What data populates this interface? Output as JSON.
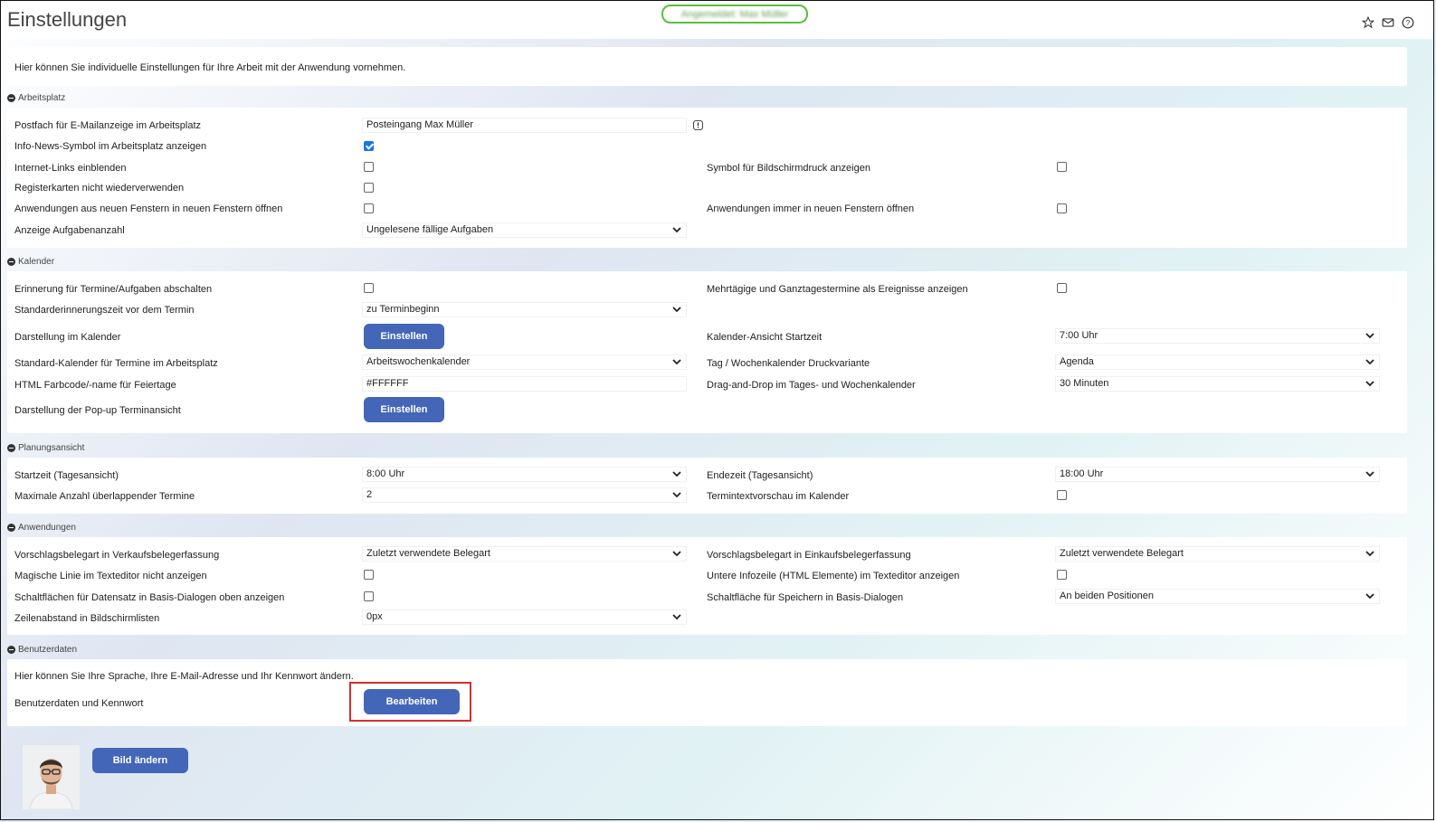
{
  "header": {
    "title": "Einstellungen",
    "badge_text": "Angemeldet: Max Müller",
    "icons": [
      "star-icon",
      "mail-icon",
      "help-icon"
    ]
  },
  "intro": "Hier können Sie individuelle Einstellungen für Ihre Arbeit mit der Anwendung vornehmen.",
  "sections": {
    "arbeitsplatz": {
      "title": "Arbeitsplatz",
      "postfach_label": "Postfach für E-Mailanzeige im Arbeitsplatz",
      "postfach_value": "Posteingang Max Müller",
      "infonews_label": "Info-News-Symbol im Arbeitsplatz anzeigen",
      "internet_label": "Internet-Links einblenden",
      "register_label": "Registerkarten nicht wiederverwenden",
      "anwendungen_label": "Anwendungen aus neuen Fenstern in neuen Fenstern öffnen",
      "aufgaben_label": "Anzeige Aufgabenanzahl",
      "aufgaben_value": "Ungelesene fällige Aufgaben",
      "symbol_label": "Symbol für Bildschirmdruck anzeigen",
      "immer_label": "Anwendungen immer in neuen Fenstern öffnen",
      "checked": {
        "infonews": true,
        "internet": false,
        "register": false,
        "anwendungen": false,
        "symbol": false,
        "immer": false
      }
    },
    "kalender": {
      "title": "Kalender",
      "erinnerung_label": "Erinnerung für Termine/Aufgaben abschalten",
      "standard_erinnerung_label": "Standarderinnerungszeit vor dem Termin",
      "standard_erinnerung_value": "zu Terminbeginn",
      "darstellung_label": "Darstellung im Kalender",
      "standard_kalender_label": "Standard-Kalender für Termine im Arbeitsplatz",
      "standard_kalender_value": "Arbeitswochenkalender",
      "farbcode_label": "HTML Farbcode/-name für Feiertage",
      "farbcode_value": "#FFFFFF",
      "popup_label": "Darstellung der Pop-up Terminansicht",
      "mehrtaegig_label": "Mehrtägige und Ganztagestermine als Ereignisse anzeigen",
      "startzeit_label": "Kalender-Ansicht Startzeit",
      "startzeit_value": "7:00 Uhr",
      "druck_label": "Tag / Wochenkalender Druckvariante",
      "druck_value": "Agenda",
      "dragdrop_label": "Drag-and-Drop im Tages- und Wochenkalender",
      "dragdrop_value": "30 Minuten",
      "button_label": "Einstellen"
    },
    "planung": {
      "title": "Planungsansicht",
      "start_label": "Startzeit (Tagesansicht)",
      "start_value": "8:00 Uhr",
      "max_label": "Maximale Anzahl überlappender Termine",
      "max_value": "2",
      "ende_label": "Endezeit (Tagesansicht)",
      "ende_value": "18:00 Uhr",
      "vorschau_label": "Termintextvorschau im Kalender"
    },
    "anwendungen": {
      "title": "Anwendungen",
      "verkauf_label": "Vorschlagsbelegart in Verkaufsbelegerfassung",
      "verkauf_value": "Zuletzt verwendete Belegart",
      "magisch_label": "Magische Linie im Texteditor nicht anzeigen",
      "schalt_label": "Schaltflächen für Datensatz in Basis-Dialogen oben anzeigen",
      "zeilen_label": "Zeilenabstand in Bildschirmlisten",
      "zeilen_value": "0px",
      "einkauf_label": "Vorschlagsbelegart in Einkaufsbelegerfassung",
      "einkauf_value": "Zuletzt verwendete Belegart",
      "infozeile_label": "Untere Infozeile (HTML Elemente) im Texteditor anzeigen",
      "speichern_label": "Schaltfläche für Speichern in Basis-Dialogen",
      "speichern_value": "An beiden Positionen"
    },
    "benutzer": {
      "title": "Benutzerdaten",
      "info": "Hier können Sie Ihre Sprache, Ihre E-Mail-Adresse und Ihr Kennwort ändern.",
      "kennwort_label": "Benutzerdaten und Kennwort",
      "button_label": "Bearbeiten"
    }
  },
  "profile": {
    "button_label": "Bild ändern"
  },
  "colors": {
    "accent": "#4466b8",
    "highlight": "#d32f2f",
    "badge": "#5bbf3a"
  }
}
